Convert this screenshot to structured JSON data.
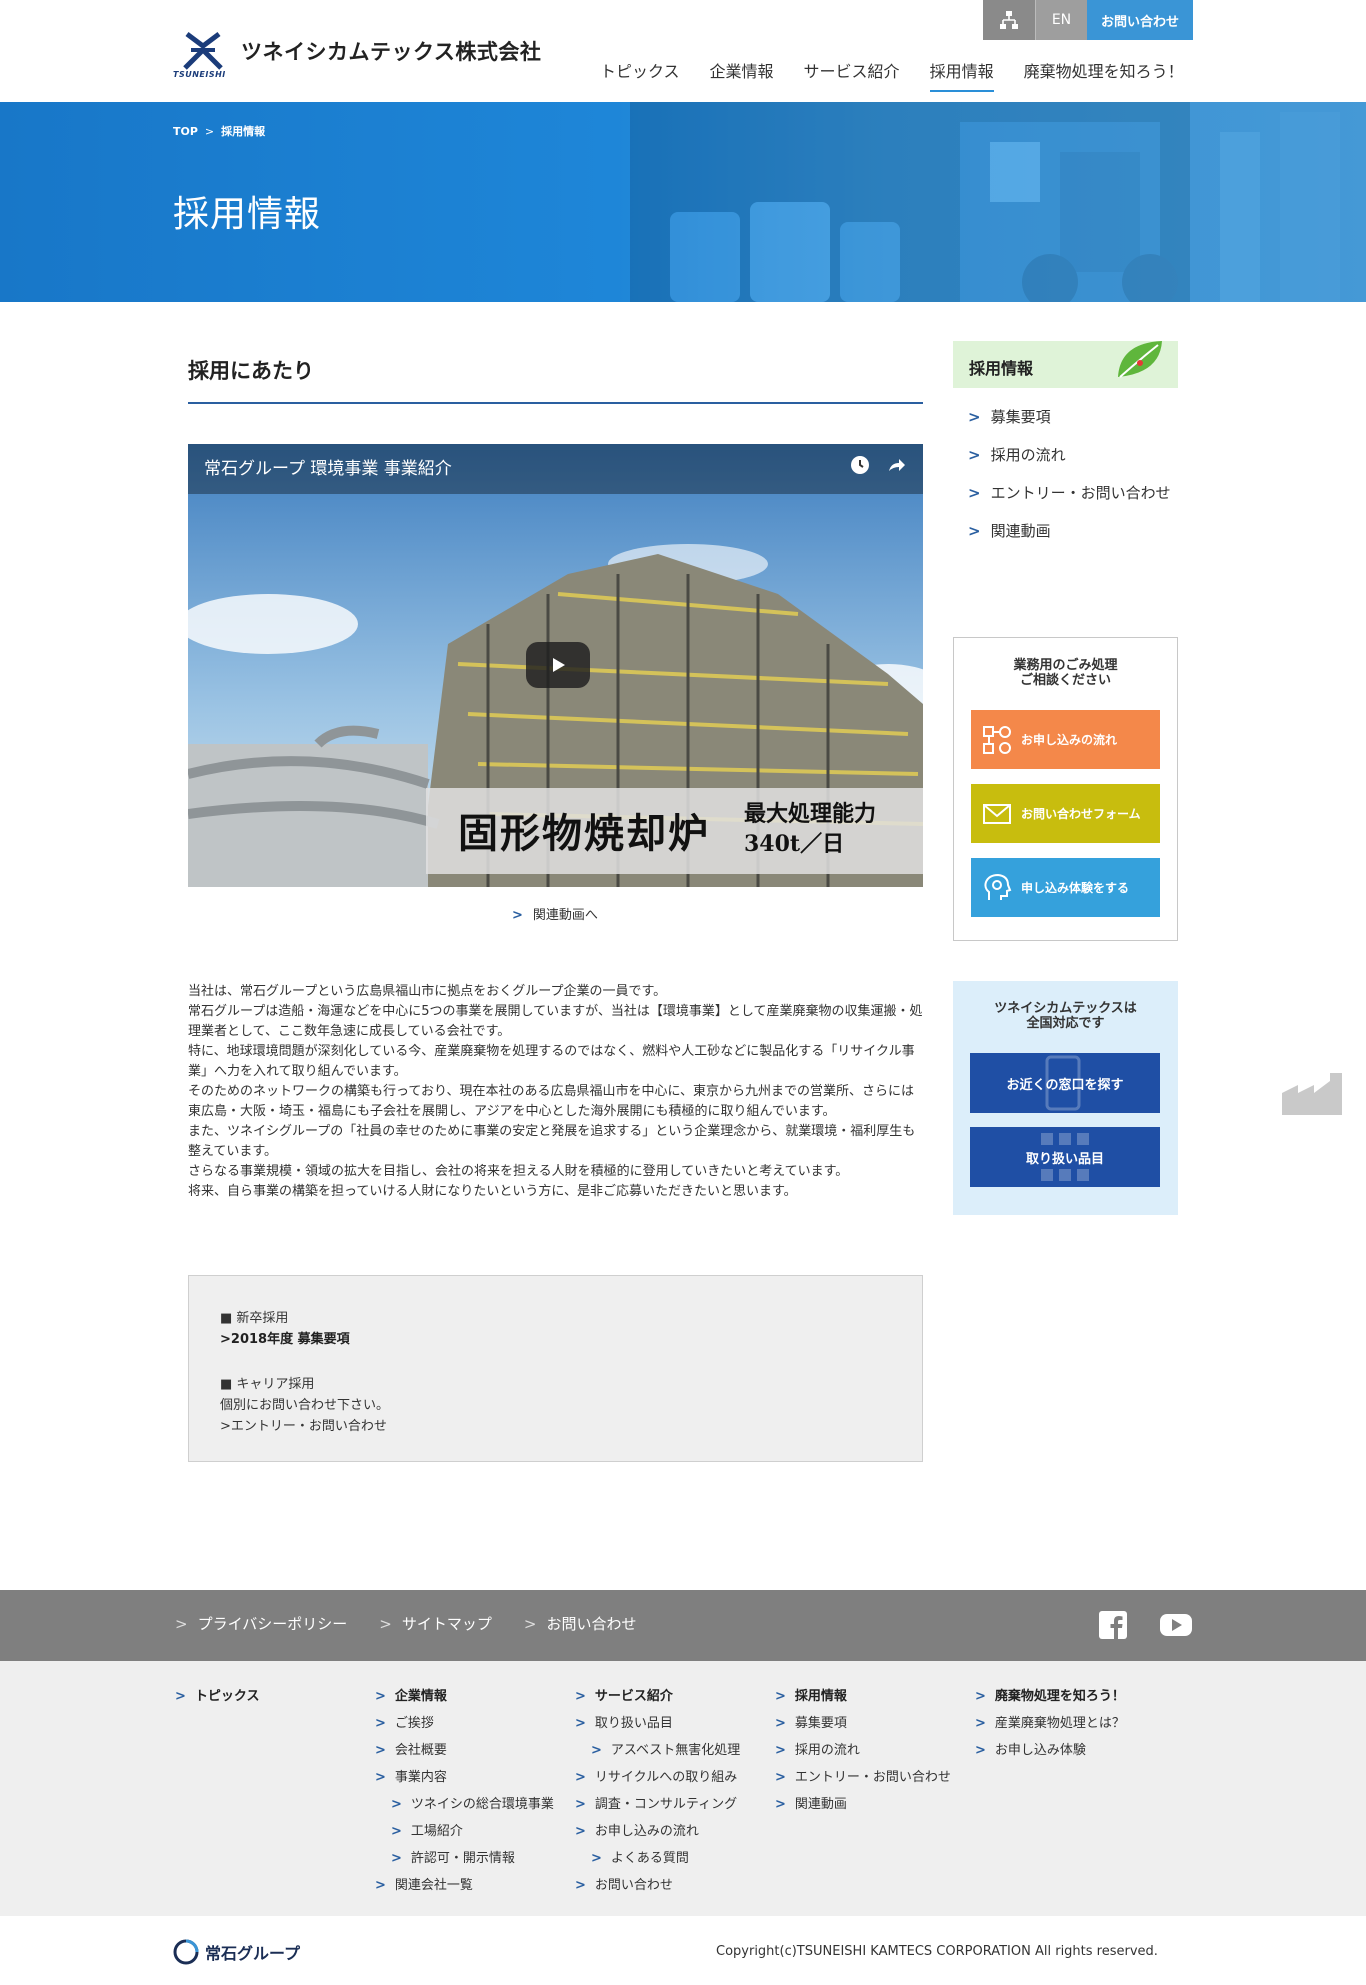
{
  "header": {
    "company_name": "ツネイシカムテックス株式会社",
    "logo_sub": "TSUNEISHI",
    "utils": {
      "sitemap_icon": "sitemap-icon",
      "en_label": "EN",
      "contact_label": "お問い合わせ"
    },
    "nav": [
      {
        "label": "トピックス",
        "active": false
      },
      {
        "label": "企業情報",
        "active": false
      },
      {
        "label": "サービス紹介",
        "active": false
      },
      {
        "label": "採用情報",
        "active": true
      },
      {
        "label": "廃棄物処理を知ろう！",
        "active": false
      }
    ]
  },
  "hero": {
    "breadcrumb": [
      "TOP",
      "採用情報"
    ],
    "title": "採用情報"
  },
  "main": {
    "section_title": "採用にあたり",
    "video": {
      "title": "常石グループ 環境事業 事業紹介",
      "caption_main": "固形物焼却炉",
      "caption_sub1": "最大処理能力",
      "caption_sub2": "340t／日"
    },
    "related_link": "関連動画へ",
    "paragraphs": [
      "当社は、常石グループという広島県福山市に拠点をおくグループ企業の一員です。",
      "常石グループは造船・海運などを中心に5つの事業を展開していますが、当社は【環境事業】として産業廃棄物の収集運搬・処理業者として、ここ数年急速に成長している会社です。",
      "特に、地球環境問題が深刻化している今、産業廃棄物を処理するのではなく、燃料や人工砂などに製品化する「リサイクル事業」へ力を入れて取り組んでいます。",
      "そのためのネットワークの構築も行っており、現在本社のある広島県福山市を中心に、東京から九州までの営業所、さらには東広島・大阪・埼玉・福島にも子会社を展開し、アジアを中心とした海外展開にも積極的に取り組んでいます。",
      "また、ツネイシグループの「社員の幸せのために事業の安定と発展を追求する」という企業理念から、就業環境・福利厚生も整えています。",
      "さらなる事業規模・領域の拡大を目指し、会社の将来を担える人財を積極的に登用していきたいと考えています。",
      "将来、自ら事業の構築を担っていける人財になりたいという方に、是非ご応募いただきたいと思います。"
    ],
    "info": {
      "new_grad_heading": "■ 新卒採用",
      "new_grad_link": "2018年度 募集要項",
      "career_heading": "■ キャリア採用",
      "career_text": "個別にお問い合わせ下さい。",
      "career_link": "エントリー・お問い合わせ"
    }
  },
  "sidebar": {
    "heading": "採用情報",
    "items": [
      "募集要項",
      "採用の流れ",
      "エントリー・お問い合わせ",
      "関連動画"
    ],
    "contact": {
      "heading_1": "業務用のごみ処理",
      "heading_2": "ご相談ください",
      "btn_apply_flow": "お申し込みの流れ",
      "btn_form": "お問い合わせフォーム",
      "btn_trial": "申し込み体験をする"
    },
    "nation": {
      "heading_1": "ツネイシカムテックスは",
      "heading_2": "全国対応です",
      "btn_office": "お近くの窓口を探す",
      "btn_items": "取り扱い品目"
    }
  },
  "footer": {
    "bar_links": [
      "プライバシーポリシー",
      "サイトマップ",
      "お問い合わせ"
    ],
    "social": [
      "facebook-icon",
      "youtube-icon"
    ],
    "columns": [
      {
        "heading": "トピックス",
        "items": []
      },
      {
        "heading": "企業情報",
        "items": [
          {
            "label": "ご挨拶",
            "sub": false
          },
          {
            "label": "会社概要",
            "sub": false
          },
          {
            "label": "事業内容",
            "sub": false
          },
          {
            "label": "ツネイシの総合環境事業",
            "sub": true
          },
          {
            "label": "工場紹介",
            "sub": true
          },
          {
            "label": "許認可・開示情報",
            "sub": true
          },
          {
            "label": "関連会社一覧",
            "sub": false
          }
        ]
      },
      {
        "heading": "サービス紹介",
        "items": [
          {
            "label": "取り扱い品目",
            "sub": false
          },
          {
            "label": "アスベスト無害化処理",
            "sub": true
          },
          {
            "label": "リサイクルへの取り組み",
            "sub": false
          },
          {
            "label": "調査・コンサルティング",
            "sub": false
          },
          {
            "label": "お申し込みの流れ",
            "sub": false
          },
          {
            "label": "よくある質問",
            "sub": true
          },
          {
            "label": "お問い合わせ",
            "sub": false
          }
        ]
      },
      {
        "heading": "採用情報",
        "items": [
          {
            "label": "募集要項",
            "sub": false
          },
          {
            "label": "採用の流れ",
            "sub": false
          },
          {
            "label": "エントリー・お問い合わせ",
            "sub": false
          },
          {
            "label": "関連動画",
            "sub": false
          }
        ]
      },
      {
        "heading": "廃棄物処理を知ろう！",
        "items": [
          {
            "label": "産業廃棄物処理とは？",
            "sub": false
          },
          {
            "label": "お申し込み体験",
            "sub": false
          }
        ]
      }
    ],
    "group_logo": "常石グループ",
    "copyright": "Copyright(c)TSUNEISHI KAMTECS CORPORATION All rights reserved."
  },
  "colors": {
    "brand_blue": "#1e86d8",
    "nav_blue": "#1f4fa5",
    "orange": "#f4884a",
    "olive": "#c8bd0e",
    "light_blue": "#35a1dc",
    "green_head": "#dff3d8"
  }
}
